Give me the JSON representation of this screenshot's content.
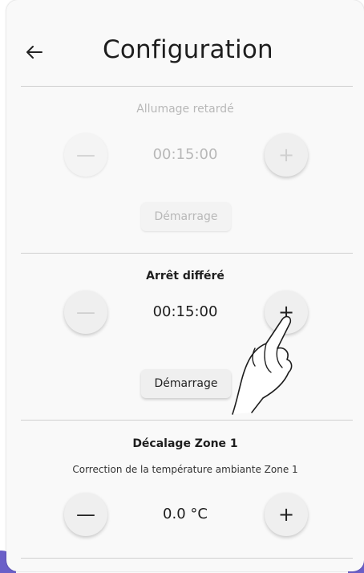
{
  "header": {
    "title": "Configuration",
    "back_icon": "arrow-left-icon"
  },
  "delayed_start": {
    "title": "Allumage retardé",
    "value": "00:15:00",
    "button_label": "Démarrage",
    "state": "disabled"
  },
  "delayed_stop": {
    "title": "Arrêt différé",
    "value": "00:15:00",
    "button_label": "Démarrage"
  },
  "zone_offset": {
    "title": "Décalage Zone 1",
    "subtitle": "Correction de la température ambiante Zone 1",
    "value": "0.0 °C"
  },
  "glyphs": {
    "minus": "—",
    "plus": "+"
  },
  "colors": {
    "card_bg": "#f9f9f9",
    "accent": "#6a5fc8",
    "disabled_text": "#b8b8b8"
  }
}
